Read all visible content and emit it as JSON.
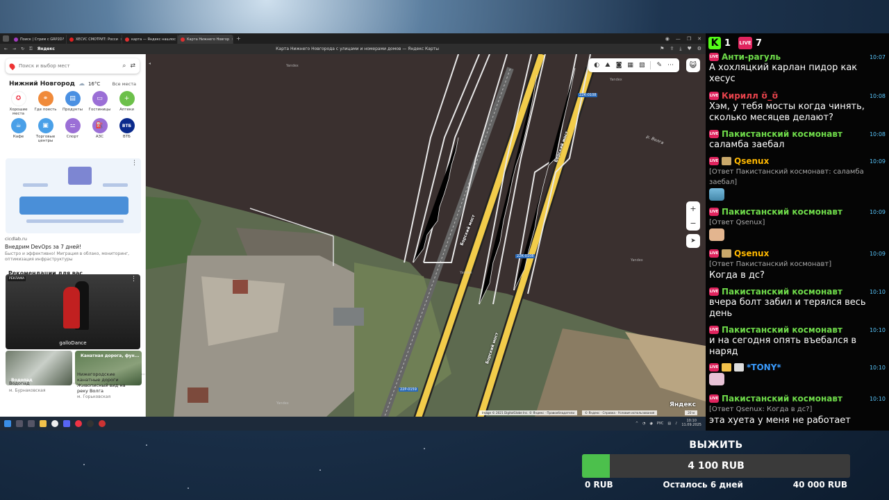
{
  "browser": {
    "tabs": [
      {
        "label": "Поиск | Стрим с GRP2D?",
        "color": "#a33cc0"
      },
      {
        "label": "ХЕСУС СМОТРИТ: Росси",
        "color": "#e02020"
      },
      {
        "label": "карта — Яндекс нашлос",
        "color": "#e03030"
      },
      {
        "label": "Карта Нижнего Новгор",
        "color": "#e03030"
      }
    ],
    "brand": "Яндекс",
    "page_title": "Карта Нижнего Новгорода с улицами и номерами домов — Яндекс Карты"
  },
  "sidebar": {
    "search_placeholder": "Поиск и выбор мест",
    "city": "Нижний Новгород",
    "temperature": "16°C",
    "all_places": "Все места",
    "categories": [
      {
        "label": "Хорошие места",
        "icon": "award-icon",
        "color": "#ffffff"
      },
      {
        "label": "Где поесть",
        "icon": "fork-knife-icon",
        "color": "#f08a3a"
      },
      {
        "label": "Продукты",
        "icon": "basket-icon",
        "color": "#4a90e2"
      },
      {
        "label": "Гостиницы",
        "icon": "bed-icon",
        "color": "#9b6fd6"
      },
      {
        "label": "Аптеки",
        "icon": "plus-icon",
        "color": "#6cc04a"
      },
      {
        "label": "Кафе",
        "icon": "cup-icon",
        "color": "#4aa0e8"
      },
      {
        "label": "Торговые центры",
        "icon": "bag-icon",
        "color": "#4aa0e8"
      },
      {
        "label": "Спорт",
        "icon": "dumbbell-icon",
        "color": "#9b6fd6"
      },
      {
        "label": "АЗС",
        "icon": "fuel-icon",
        "color": "#9b6fd6"
      },
      {
        "label": "ВТБ",
        "icon": "vtb-logo",
        "color": "#0a2a8c"
      }
    ],
    "ad_source": "cicdlab.ru",
    "ad_title": "Внедрим DevOps за 7 дней!",
    "ad_desc": "Быстро и эффективно! Миграция в облако, мониторинг, оптимизация инфраструктуры",
    "recommendations": "Рекомендации для вас",
    "promo_badge": "РЕКЛАМА",
    "promo_logo": "galloDance",
    "cards": [
      {
        "overlay": "Водопад",
        "title": "Водопад",
        "subtitle": "м. Бурнаковская"
      },
      {
        "overlay": "Канатная дорога, фун...",
        "title": "Нижегородские канатные дороги",
        "desc": "Живописный вид на реку Волга",
        "subtitle": "м. Горьковская"
      }
    ]
  },
  "map": {
    "river_label": "р. Волга",
    "road_label_1": "Борский мост",
    "road_label_2": "Борский мост",
    "shield_1": "22К-0108",
    "shield_2": "22К-0108",
    "shield_3": "22Р-0159",
    "watermark": "Yandex",
    "logo": "Яндекс",
    "attribution": "Image © 2021 DigitalGlobe Inc. © Яндекс · Правообладатели",
    "attribution2": "© Яндекс · Справка · Условия использования",
    "scale": "20 м"
  },
  "taskbar": {
    "lang": "РУС",
    "time": "10:10",
    "date": "11.09.2025"
  },
  "chat": {
    "kick_count": "1",
    "live_count": "7",
    "messages": [
      {
        "user": "Анти-рагуль",
        "color": "#6fdc4a",
        "time": "10:07",
        "text": "А хохляцкий карлан пидор как хесус"
      },
      {
        "user": "Кирилл ʊ̄_ʊ̄",
        "color": "#e8434c",
        "time": "10:08",
        "text": "Хэм, у тебя мосты когда чинять, сколько месяцев делают?"
      },
      {
        "user": "Пакистанский космонавт",
        "color": "#6fdc4a",
        "time": "10:08",
        "text": "саламба заебал"
      },
      {
        "user": "Qsenux",
        "color": "#ffb800",
        "time": "10:09",
        "reply": "[Ответ Пакистанский космонавт: саламба заебал]"
      },
      {
        "user": "Пакистанский космонавт",
        "color": "#6fdc4a",
        "time": "10:09",
        "reply": "[Ответ Qsenux]"
      },
      {
        "user": "Qsenux",
        "color": "#ffb800",
        "time": "10:09",
        "reply": "[Ответ Пакистанский космонавт]",
        "text": "Когда в дс?"
      },
      {
        "user": "Пакистанский космонавт",
        "color": "#6fdc4a",
        "time": "10:10",
        "text": "вчера болт забил и терялся весь день"
      },
      {
        "user": "Пакистанский космонавт",
        "color": "#6fdc4a",
        "time": "10:10",
        "text": "и на сегодня опять въебался в наряд"
      },
      {
        "user": "*TONY*",
        "color": "#3a9cff",
        "time": "10:10"
      },
      {
        "user": "Пакистанский космонавт",
        "color": "#6fdc4a",
        "time": "10:10",
        "reply": "[Ответ Qsenux: Когда в дс?]",
        "text": "эта хуета у меня не работает"
      }
    ]
  },
  "goal": {
    "title": "ВЫЖИТЬ",
    "current": "4 100 RUB",
    "min": "0 RUB",
    "remaining": "Осталось 6 дней",
    "max": "40 000 RUB",
    "progress": 0.1025,
    "fill_color": "#4cc04c"
  }
}
